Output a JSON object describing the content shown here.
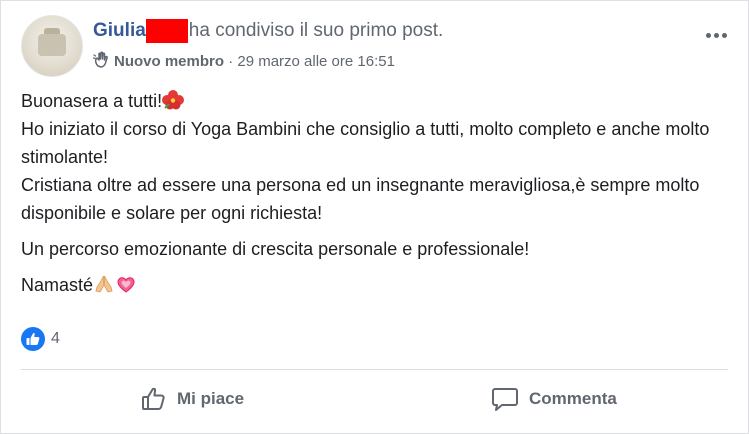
{
  "post": {
    "author": "Giulia",
    "action": "ha condiviso il suo primo post.",
    "badge": "Nuovo membro",
    "timestamp": "· 29 marzo alle ore 16:51",
    "lines": [
      "Buonasera a tutti!",
      "Ho iniziato il corso di Yoga Bambini che consiglio a tutti, molto completo e anche molto stimolante!",
      "Cristiana oltre ad essere una persona ed un insegnante meravigliosa,è sempre molto disponibile e solare per ogni richiesta!",
      "Un percorso emozionante di crescita personale e professionale!",
      "Namasté"
    ],
    "reactions_count": "4"
  },
  "actions": {
    "like_label": "Mi piace",
    "comment_label": "Commenta"
  },
  "colors": {
    "author": "#385898",
    "secondary": "#606770",
    "like_blue": "#1877f2",
    "redaction": "#ff0000"
  }
}
